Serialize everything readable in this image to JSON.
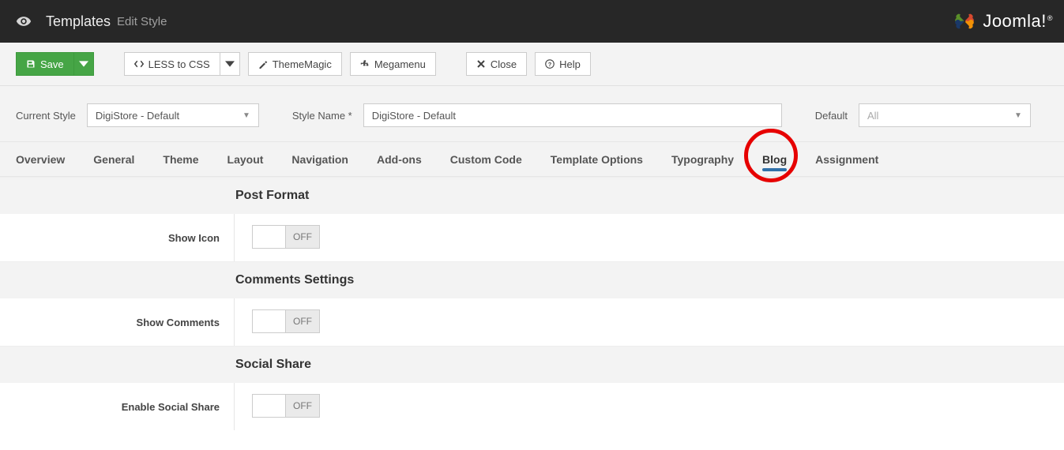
{
  "header": {
    "title": "Templates",
    "subtitle": "Edit Style",
    "brand": "Joomla!",
    "brand_r": "®"
  },
  "toolbar": {
    "save": "Save",
    "less_to_css": "LESS to CSS",
    "thememagic": "ThemeMagic",
    "megamenu": "Megamenu",
    "close": "Close",
    "help": "Help"
  },
  "style_row": {
    "current_style_label": "Current Style",
    "current_style_value": "DigiStore - Default",
    "style_name_label": "Style Name *",
    "style_name_value": "DigiStore - Default",
    "default_label": "Default",
    "default_value": "All"
  },
  "tabs": [
    "Overview",
    "General",
    "Theme",
    "Layout",
    "Navigation",
    "Add-ons",
    "Custom Code",
    "Template Options",
    "Typography",
    "Blog",
    "Assignment"
  ],
  "active_tab_index": 9,
  "sections": {
    "post_format": {
      "heading": "Post Format",
      "show_icon_label": "Show Icon",
      "show_icon_value": "OFF"
    },
    "comments": {
      "heading": "Comments Settings",
      "show_comments_label": "Show Comments",
      "show_comments_value": "OFF"
    },
    "social": {
      "heading": "Social Share",
      "enable_label": "Enable Social Share",
      "enable_value": "OFF"
    }
  }
}
